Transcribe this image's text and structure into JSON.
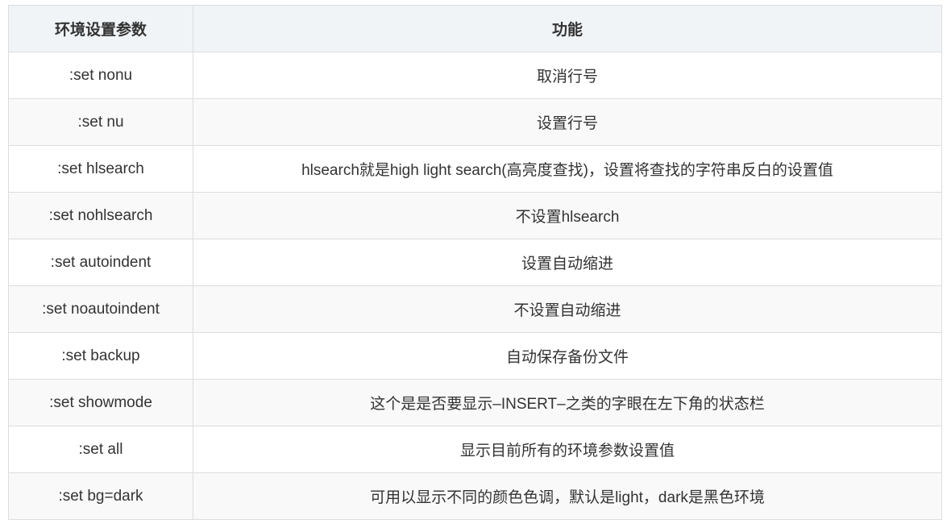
{
  "table": {
    "headers": [
      "环境设置参数",
      "功能"
    ],
    "rows": [
      [
        ":set nonu",
        "取消行号"
      ],
      [
        ":set nu",
        "设置行号"
      ],
      [
        ":set hlsearch",
        "hlsearch就是high light search(高亮度查找)，设置将查找的字符串反白的设置值"
      ],
      [
        ":set nohlsearch",
        "不设置hlsearch"
      ],
      [
        ":set autoindent",
        "设置自动缩进"
      ],
      [
        ":set noautoindent",
        "不设置自动缩进"
      ],
      [
        ":set backup",
        "自动保存备份文件"
      ],
      [
        ":set showmode",
        "这个是是否要显示–INSERT–之类的字眼在左下角的状态栏"
      ],
      [
        ":set all",
        "显示目前所有的环境参数设置值"
      ],
      [
        ":set bg=dark",
        "可用以显示不同的颜色色调，默认是light，dark是黑色环境"
      ]
    ]
  }
}
